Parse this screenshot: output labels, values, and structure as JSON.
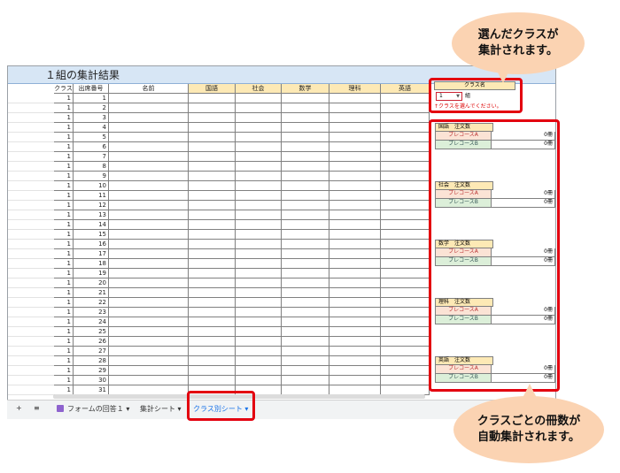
{
  "sheet": {
    "title": "１組の集計結果",
    "columns": [
      "クラス",
      "出席番号",
      "名前",
      "国語",
      "社会",
      "数学",
      "理科",
      "英語"
    ],
    "class_value": "1",
    "rows": [
      "1",
      "2",
      "3",
      "4",
      "5",
      "6",
      "7",
      "8",
      "9",
      "10",
      "11",
      "12",
      "13",
      "14",
      "15",
      "16",
      "17",
      "18",
      "19",
      "20",
      "21",
      "22",
      "23",
      "24",
      "25",
      "26",
      "27",
      "28",
      "29",
      "30",
      "31"
    ]
  },
  "class_panel": {
    "header": "クラス名",
    "selected": "1",
    "unit": "組",
    "note": "↑クラスを選んでください。"
  },
  "order_panels": [
    {
      "header": "国語　注文数",
      "rows": [
        {
          "label": "プレコースA",
          "value": "0冊"
        },
        {
          "label": "プレコースB",
          "value": "0冊"
        }
      ]
    },
    {
      "header": "社会　注文数",
      "rows": [
        {
          "label": "プレコースA",
          "value": "0冊"
        },
        {
          "label": "プレコースB",
          "value": "0冊"
        }
      ]
    },
    {
      "header": "数学　注文数",
      "rows": [
        {
          "label": "プレコースA",
          "value": "0冊"
        },
        {
          "label": "プレコースB",
          "value": "0冊"
        }
      ]
    },
    {
      "header": "理科　注文数",
      "rows": [
        {
          "label": "プレコースA",
          "value": "0冊"
        },
        {
          "label": "プレコースB",
          "value": "0冊"
        }
      ]
    },
    {
      "header": "英語　注文数",
      "rows": [
        {
          "label": "プレコースA",
          "value": "0冊"
        },
        {
          "label": "プレコースB",
          "value": "0冊"
        }
      ]
    }
  ],
  "tabs": {
    "add": "+",
    "menu": "≡",
    "items": [
      {
        "label": "フォームの回答１",
        "arrow": "▾"
      },
      {
        "label": "集計シート",
        "arrow": "▾"
      },
      {
        "label": "クラス別シート",
        "arrow": "▾"
      }
    ]
  },
  "callouts": {
    "top": "選んだクラスが\n集計されます。",
    "bottom": "クラスごとの冊数が\n自動集計されます。"
  },
  "colors": {
    "accent_red": "#e3000f",
    "bubble": "#fbd3b2",
    "header_yellow": "#fde9b5",
    "title_blue": "#d7e6f5"
  }
}
